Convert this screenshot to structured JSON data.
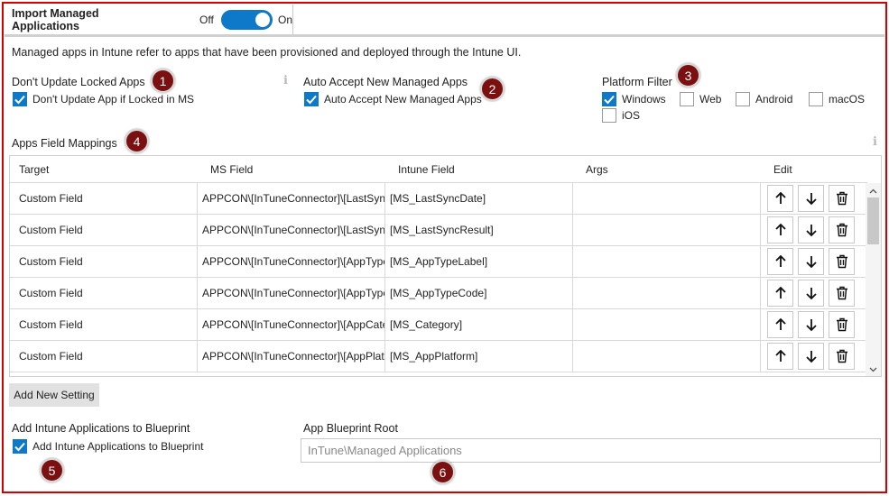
{
  "header": {
    "title": "Import Managed Applications",
    "toggle_off_label": "Off",
    "toggle_on_label": "On",
    "toggle_state": "on"
  },
  "description": "Managed apps in Intune refer to apps that have been provisioned and deployed through the Intune UI.",
  "locked_apps": {
    "label": "Don't Update Locked Apps",
    "checkbox_label": "Don't Update App if Locked in MS",
    "checked": true
  },
  "auto_accept": {
    "label": "Auto Accept New Managed Apps",
    "checkbox_label": "Auto Accept New Managed Apps",
    "checked": true
  },
  "platform_filter": {
    "label": "Platform Filter",
    "options": [
      {
        "label": "Windows",
        "checked": true
      },
      {
        "label": "Web",
        "checked": false
      },
      {
        "label": "Android",
        "checked": false
      },
      {
        "label": "macOS",
        "checked": false
      },
      {
        "label": "iOS",
        "checked": false
      }
    ]
  },
  "mappings": {
    "label": "Apps Field Mappings",
    "columns": [
      "Target",
      "MS Field",
      "Intune Field",
      "Args",
      "Edit"
    ],
    "rows": [
      {
        "target": "Custom Field",
        "ms_field": "APPCON\\[InTuneConnector]\\[LastSyncDate]",
        "intune_field": "[MS_LastSyncDate]",
        "args": ""
      },
      {
        "target": "Custom Field",
        "ms_field": "APPCON\\[InTuneConnector]\\[LastSyncResult]",
        "intune_field": "[MS_LastSyncResult]",
        "args": ""
      },
      {
        "target": "Custom Field",
        "ms_field": "APPCON\\[InTuneConnector]\\[AppTypeLabel]",
        "intune_field": "[MS_AppTypeLabel]",
        "args": ""
      },
      {
        "target": "Custom Field",
        "ms_field": "APPCON\\[InTuneConnector]\\[AppTypeCode]",
        "intune_field": "[MS_AppTypeCode]",
        "args": ""
      },
      {
        "target": "Custom Field",
        "ms_field": "APPCON\\[InTuneConnector]\\[AppCategory]",
        "intune_field": "[MS_Category]",
        "args": ""
      },
      {
        "target": "Custom Field",
        "ms_field": "APPCON\\[InTuneConnector]\\[AppPlatform]",
        "intune_field": "[MS_AppPlatform]",
        "args": ""
      }
    ]
  },
  "add_setting_label": "Add New Setting",
  "blueprint": {
    "label": "Add Intune Applications to Blueprint",
    "checkbox_label": "Add Intune Applications to Blueprint",
    "checked": true
  },
  "blueprint_root": {
    "label": "App Blueprint Root",
    "value": "InTune\\Managed Applications"
  },
  "callouts": [
    "1",
    "2",
    "3",
    "4",
    "5",
    "6"
  ],
  "colors": {
    "accent": "#0e78c9",
    "callout": "#7a1010",
    "frame_border": "#d40000"
  }
}
